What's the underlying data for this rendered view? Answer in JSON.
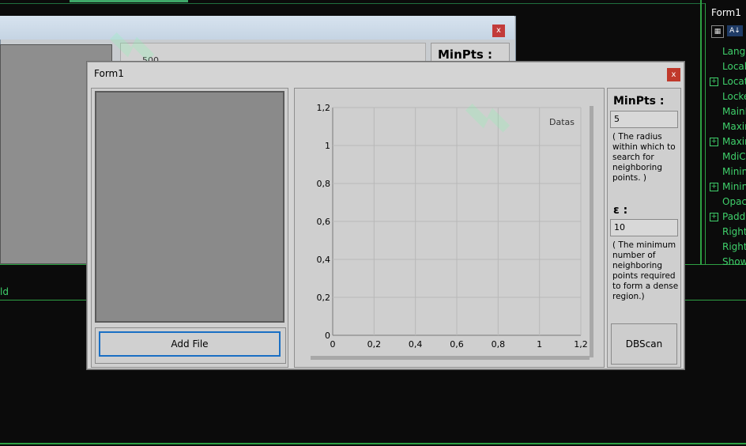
{
  "ide": {
    "properties_title": "Form1",
    "property_items": [
      {
        "label": "Langu",
        "expandable": false
      },
      {
        "label": "Locali",
        "expandable": false
      },
      {
        "label": "Locati",
        "expandable": true
      },
      {
        "label": "Locke",
        "expandable": false
      },
      {
        "label": "MainI",
        "expandable": false
      },
      {
        "label": "Maxim",
        "expandable": false
      },
      {
        "label": "Maxin",
        "expandable": true
      },
      {
        "label": "MdiC",
        "expandable": false
      },
      {
        "label": "Minim",
        "expandable": false
      },
      {
        "label": "Minin",
        "expandable": true
      },
      {
        "label": "Opaci",
        "expandable": false
      },
      {
        "label": "Paddi",
        "expandable": true
      },
      {
        "label": "RightT",
        "expandable": false
      },
      {
        "label": "RightT",
        "expandable": false
      },
      {
        "label": "Show",
        "expandable": false
      }
    ],
    "lower_text": "ld"
  },
  "back_window": {
    "close": "x",
    "minpts_label": "MinPts :",
    "value_500": "500"
  },
  "form": {
    "title": "Form1",
    "close": "x",
    "add_file_label": "Add File",
    "minpts_label": "MinPts :",
    "minpts_value": "5",
    "minpts_desc": "( The radius within which to search for  neighboring points. )",
    "eps_label": "ε :",
    "eps_value": "10",
    "eps_desc": "( The minimum number of neighboring points required to form a dense region.)",
    "dbscan_label": "DBScan"
  },
  "chart_data": {
    "type": "scatter",
    "series": [
      {
        "name": "Datas",
        "x": [],
        "y": []
      }
    ],
    "xlim": [
      0,
      1.2
    ],
    "ylim": [
      0,
      1.2
    ],
    "x_ticks": [
      "0",
      "0,2",
      "0,4",
      "0,6",
      "0,8",
      "1",
      "1,2"
    ],
    "y_ticks": [
      "0",
      "0,2",
      "0,4",
      "0,6",
      "0,8",
      "1",
      "1,2"
    ],
    "grid": true,
    "legend": "top-right",
    "title": "",
    "xlabel": "",
    "ylabel": ""
  },
  "colors": {
    "ide_green": "#2ea043",
    "accent_blue": "#1a6fc4",
    "close_red": "#c0392b"
  }
}
